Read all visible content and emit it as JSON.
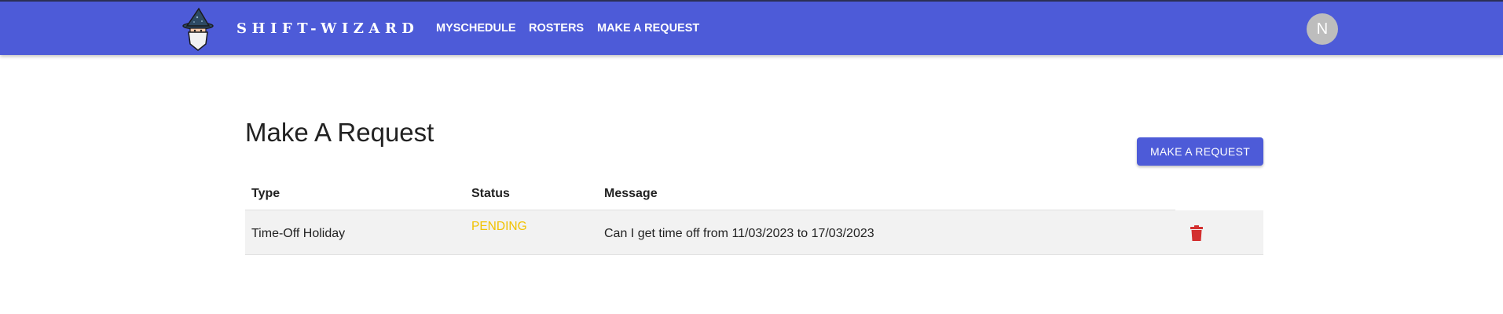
{
  "header": {
    "brand": "SHIFT-WIZARD",
    "nav": [
      {
        "label": "MYSCHEDULE"
      },
      {
        "label": "ROSTERS"
      },
      {
        "label": "MAKE A REQUEST"
      }
    ],
    "avatar_initial": "N",
    "bar_color": "#4d5bd8"
  },
  "main": {
    "title": "Make A Request",
    "make_request_button": "MAKE A REQUEST",
    "table": {
      "columns": [
        "Type",
        "Status",
        "Message"
      ],
      "rows": [
        {
          "type": "Time-Off Holiday",
          "status": "PENDING",
          "message": "Can I get time off from 11/03/2023 to 17/03/2023",
          "action_icon": "trash-icon"
        }
      ]
    }
  },
  "colors": {
    "accent": "#4d5bd8",
    "status_pending": "#f2c200",
    "delete": "#d32f2f",
    "row_background": "#f2f2f2"
  }
}
